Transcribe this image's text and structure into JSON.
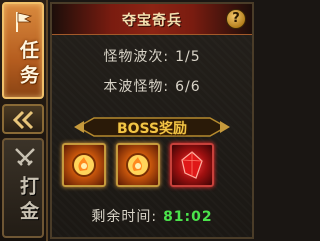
{
  "tabs": [
    {
      "label": "任务",
      "icon": "flag-icon",
      "active": true
    },
    {
      "label": "打金",
      "icon": "crossed-swords-icon",
      "active": false
    }
  ],
  "panel": {
    "title": "夺宝奇兵",
    "help_label": "?",
    "monster_wave": {
      "label": "怪物波次:",
      "value": "1/5"
    },
    "wave_monsters": {
      "label": "本波怪物:",
      "value": "6/6"
    },
    "boss_reward_title": "BOSS奖励",
    "rewards": [
      {
        "icon": "golden-flame-orb-icon"
      },
      {
        "icon": "golden-flame-orb-icon"
      },
      {
        "icon": "red-crystal-icon"
      }
    ],
    "time_remaining": {
      "label": "剩余时间:",
      "value": "81:02"
    }
  },
  "colors": {
    "accent_gold": "#f2c545",
    "timer_green": "#4be34b",
    "title_red": "#8c2414"
  }
}
